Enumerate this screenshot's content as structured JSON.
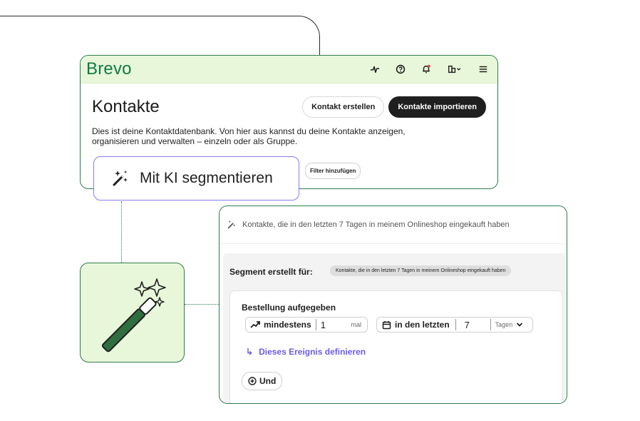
{
  "brand": "Brevo",
  "header": {
    "icons": [
      "activity-icon",
      "help-icon",
      "bell-icon",
      "building-icon",
      "menu-icon"
    ]
  },
  "contacts": {
    "title": "Kontakte",
    "create_button": "Kontakt erstellen",
    "import_button": "Kontakte importieren",
    "description": "Dies ist deine Kontaktdatenbank. Von hier aus kannst du deine Kontakte anzeigen, organisieren und verwalten – einzeln oder als Gruppe.",
    "filter_button": "Filter hinzufügen"
  },
  "ai_segment": {
    "label": "Mit KI segmentieren"
  },
  "segment": {
    "prompt": "Kontakte, die in den letzten 7 Tagen in meinem Onlineshop eingekauft haben",
    "created_for_label": "Segment erstellt für:",
    "created_for_chip": "Kontakte, die in den letzten 7 Tagen in meinem Onlineshop eingekauft haben",
    "rule_title": "Bestellung aufgegeben",
    "min_label": "mindestens",
    "min_value": "1",
    "min_unit": "mal",
    "period_label": "in den letzten",
    "period_value": "7",
    "period_unit": "Tagen",
    "define_link": "Dieses Ereignis definieren",
    "and_button": "Und"
  },
  "colors": {
    "brand_green": "#0f7a45",
    "header_bg": "#e8f7d9",
    "border_green": "#2f7a4d",
    "ai_purple": "#8a7cf0",
    "link_purple": "#6b5ce7"
  }
}
